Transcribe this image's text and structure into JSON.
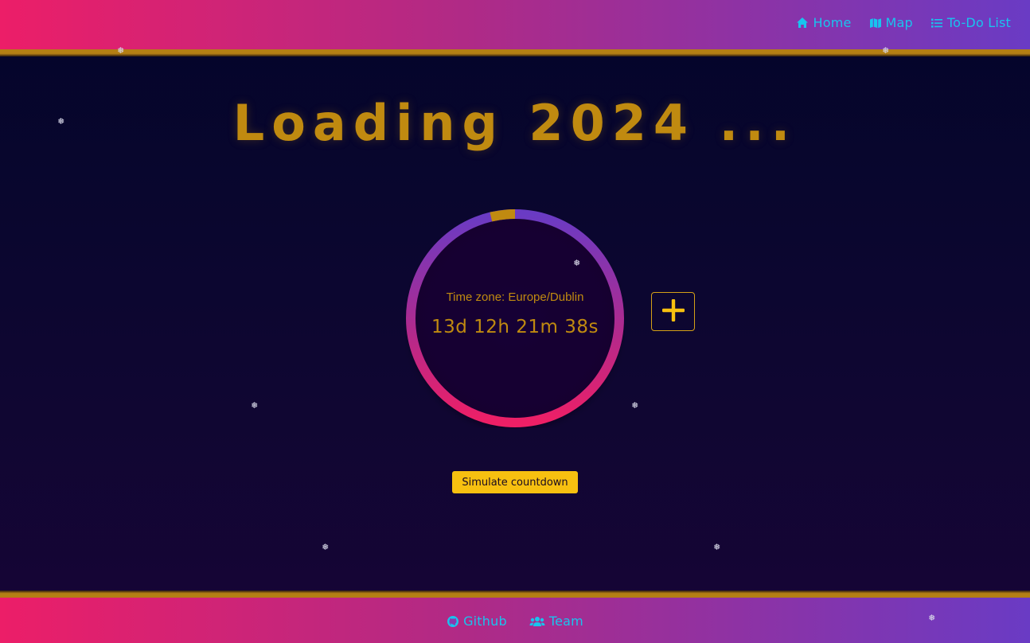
{
  "nav": {
    "items": [
      {
        "label": "Home",
        "icon": "home-icon"
      },
      {
        "label": "Map",
        "icon": "map-icon"
      },
      {
        "label": "To-Do List",
        "icon": "list-icon"
      }
    ]
  },
  "main": {
    "title": "Loading 2024 ...",
    "timezone": "Time zone: Europe/Dublin",
    "countdown": "13d 12h 21m 38s",
    "progress_remaining_fraction": 0.037,
    "add_icon": "plus-icon",
    "simulate_label": "Simulate countdown"
  },
  "footer": {
    "links": [
      {
        "label": "Github",
        "icon": "github-icon"
      },
      {
        "label": "Team",
        "icon": "team-icon"
      }
    ]
  },
  "decor": {
    "snowflake_glyph": "❅",
    "snowflake_icon": "snowflake-icon"
  },
  "colors": {
    "accent_gold": "#c08a10",
    "button_yellow": "#f7c010",
    "link_cyan": "#19c4ee",
    "gradient_pink": "#ec1e68",
    "gradient_purple": "#6a3bc4"
  }
}
